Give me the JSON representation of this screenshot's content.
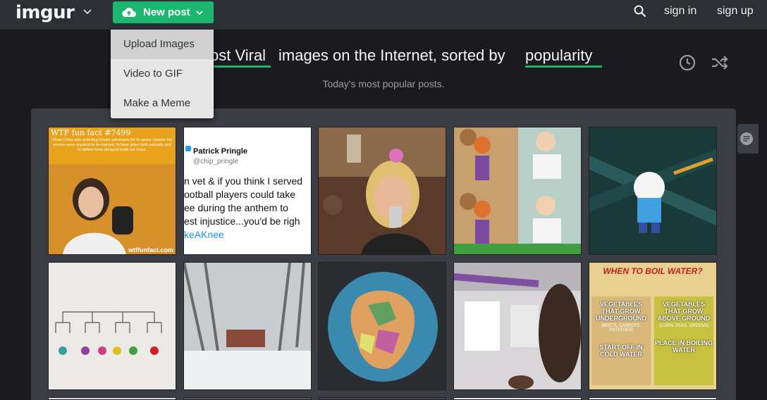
{
  "header": {
    "logo": "imgur",
    "new_post_label": "New post",
    "sign_in": "sign in",
    "sign_up": "sign up"
  },
  "dropdown": {
    "items": [
      {
        "label": "Upload Images"
      },
      {
        "label": "Video to GIF"
      },
      {
        "label": "Make a Meme"
      }
    ]
  },
  "headline": {
    "part1": "ost Viral",
    "part2": "images on the Internet, sorted by",
    "part3": "popularity",
    "subtitle": "Today's most popular posts."
  },
  "gallery": {
    "thumbs": [
      {
        "caption": "WTF fun fact #7499",
        "text": "When China was selecting female astronauts for its space mission the women were required to be married, to have given birth naturally and to neither have decayed teeth nor scars.",
        "footer": "wtffunfact.com"
      },
      {
        "name": "Patrick Pringle",
        "handle": "@chip_pringle",
        "lines": [
          "n vet & if you think I served",
          "ootball players could take",
          "ee during the anthem to",
          "est injustice...you'd be righ",
          "keAKnee"
        ]
      },
      {
        "caption": ""
      },
      {
        "caption": ""
      },
      {
        "caption": ""
      },
      {
        "caption": ""
      },
      {
        "caption": ""
      },
      {
        "caption": ""
      },
      {
        "caption": ""
      },
      {
        "title": "WHEN TO BOIL WATER?",
        "left_head": "VEGETABLES THAT GROW UNDERGROUND",
        "left_sub": "(BEETS, CARROTS, POTATOES)",
        "left_action": "START OFF IN COLD WATER",
        "right_head": "VEGETABLES THAT GROW ABOVE GROUND",
        "right_sub": "(CORN, PEAS, GREENS)",
        "right_action": "PLACE IN BOILING WATER"
      }
    ]
  },
  "colors": {
    "accent": "#1bb76e",
    "header_bg": "#2c2f34",
    "page_bg": "#1b1b1f",
    "panel_bg": "#3a3d43"
  }
}
